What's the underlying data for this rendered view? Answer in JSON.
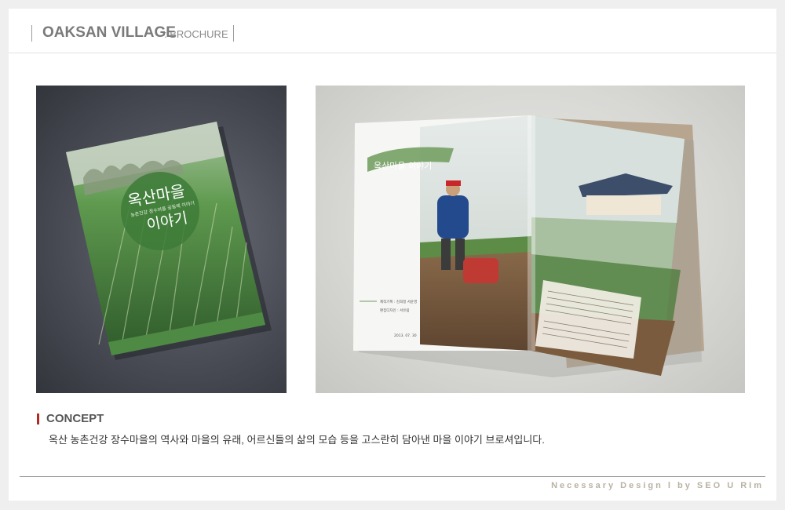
{
  "header": {
    "title": "OAKSAN VILLAGE",
    "subtitle": ": BROCHURE"
  },
  "cover": {
    "title_line1": "옥산마을",
    "title_line2": "이야기",
    "subtitle": "농촌건강 장수마을 공동체 이야기"
  },
  "spread": {
    "headline": "옥산마을 이야기",
    "credits": [
      "제작기획 : 김희정 서윤영",
      "편집디자인 : 서유림",
      "2013. 07. 30"
    ]
  },
  "concept": {
    "title": "CONCEPT",
    "description": "옥산 농촌건강 장수마을의 역사와 마을의 유래, 어르신들의 삶의 모습 등을 고스란히 담아낸 마을 이야기 브로셔입니다."
  },
  "footer": {
    "credit": "Necessary Design l by SEO U RIm"
  },
  "colors": {
    "accent": "#b22a21",
    "brand_green": "#3f7d3a"
  }
}
